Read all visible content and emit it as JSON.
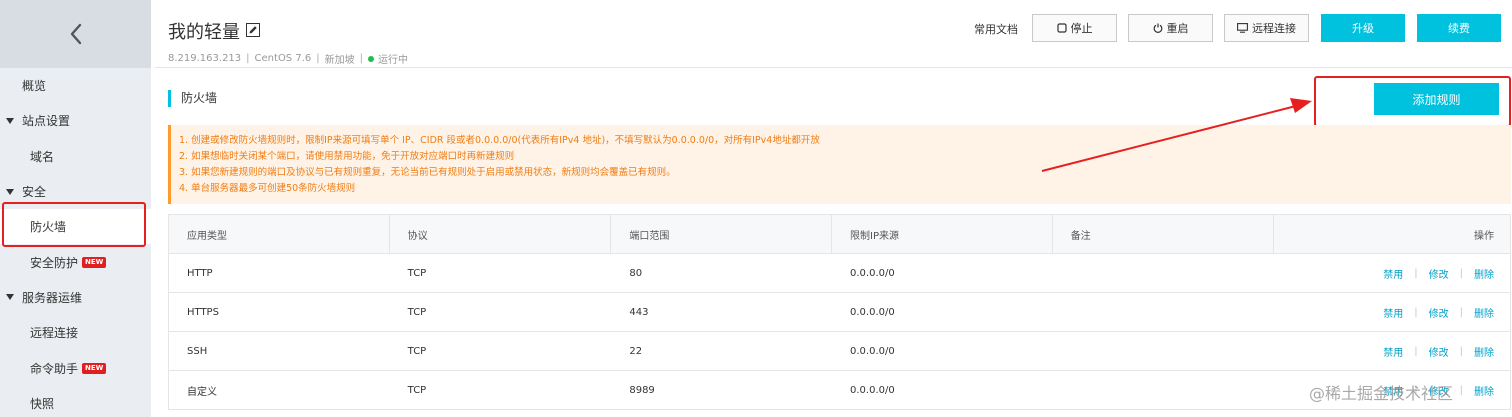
{
  "sidebar": {
    "items": [
      {
        "label": "概览"
      },
      {
        "label": "站点设置"
      },
      {
        "label": "域名"
      },
      {
        "label": "安全"
      },
      {
        "label": "防火墙"
      },
      {
        "label": "安全防护",
        "badge": "NEW"
      },
      {
        "label": "服务器运维"
      },
      {
        "label": "远程连接"
      },
      {
        "label": "命令助手",
        "badge": "NEW"
      },
      {
        "label": "快照"
      }
    ]
  },
  "header": {
    "title": "我的轻量",
    "ip": "8.219.163.213",
    "os": "CentOS 7.6",
    "region": "新加坡",
    "status": "运行中",
    "doc_link": "常用文档",
    "btn_stop": "停止",
    "btn_restart": "重启",
    "btn_remote": "远程连接",
    "btn_upgrade": "升级",
    "btn_renew": "续费"
  },
  "firewall": {
    "title": "防火墙",
    "add_button": "添加规则",
    "notices": [
      "1. 创建或修改防火墙规则时，限制IP来源可填写单个 IP、CIDR 段或者0.0.0.0/0(代表所有IPv4 地址)，不填写默认为0.0.0.0/0，对所有IPv4地址都开放",
      "2. 如果想临时关闭某个端口，请使用禁用功能，免于开放对应端口时再新建规则",
      "3. 如果您新建规则的端口及协议与已有规则重复，无论当前已有规则处于启用或禁用状态，新规则均会覆盖已有规则。",
      "4. 单台服务器最多可创建50条防火墙规则"
    ],
    "columns": [
      "应用类型",
      "协议",
      "端口范围",
      "限制IP来源",
      "备注",
      "操作"
    ],
    "rows": [
      {
        "type": "HTTP",
        "protocol": "TCP",
        "port": "80",
        "source": "0.0.0.0/0",
        "note": ""
      },
      {
        "type": "HTTPS",
        "protocol": "TCP",
        "port": "443",
        "source": "0.0.0.0/0",
        "note": ""
      },
      {
        "type": "SSH",
        "protocol": "TCP",
        "port": "22",
        "source": "0.0.0.0/0",
        "note": ""
      },
      {
        "type": "自定义",
        "protocol": "TCP",
        "port": "8989",
        "source": "0.0.0.0/0",
        "note": ""
      }
    ],
    "actions": {
      "disable": "禁用",
      "edit": "修改",
      "delete": "删除"
    }
  },
  "watermark": "@稀土掘金技术社区",
  "colors": {
    "accent": "#00c1de",
    "annotation_red": "#e61f1f",
    "notice_text": "#f07d13",
    "status_green": "#1fbf4e"
  }
}
